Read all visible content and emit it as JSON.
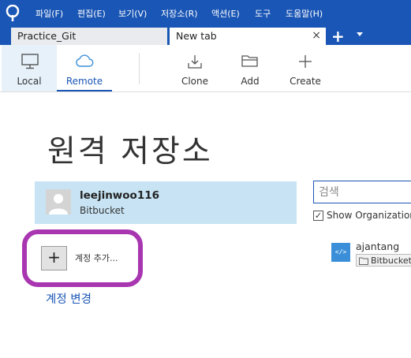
{
  "menu": {
    "items": [
      "파일(F)",
      "편집(E)",
      "보기(V)",
      "저장소(R)",
      "액션(E)",
      "도구",
      "도움말(H)"
    ]
  },
  "tabs": {
    "items": [
      {
        "label": "Practice_Git",
        "active": false
      },
      {
        "label": "New tab",
        "active": true
      }
    ],
    "close_icon": "×",
    "new_tab_icon": "+"
  },
  "toolbar": {
    "local": "Local",
    "remote": "Remote",
    "clone": "Clone",
    "add": "Add",
    "create": "Create"
  },
  "page": {
    "title": "원격 저장소"
  },
  "account": {
    "name": "leejinwoo116",
    "host": "Bitbucket"
  },
  "actions": {
    "add_account_icon": "+",
    "add_account_label": "계정 추가...",
    "change_account": "계정 변경"
  },
  "search": {
    "placeholder": "검색",
    "show_org_label": "Show Organization",
    "show_org_checked": "✓"
  },
  "repos": [
    {
      "name": "ajantang",
      "icon_text": "</>",
      "host": "Bitbucket"
    }
  ],
  "colors": {
    "brand": "#1a56b5",
    "selected": "#c8e4f4",
    "highlight": "#a836b0",
    "repo_icon": "#3b8fd9"
  }
}
